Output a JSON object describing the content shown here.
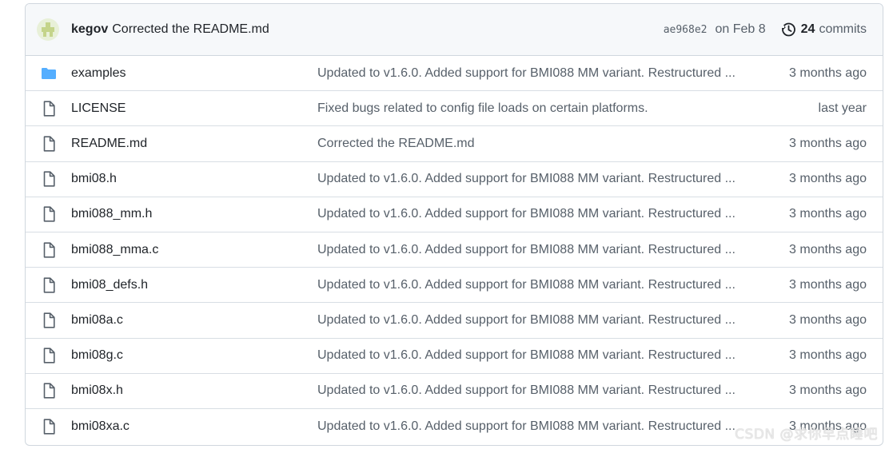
{
  "latest_commit": {
    "author": "kegov",
    "message": "Corrected the README.md",
    "sha": "ae968e2",
    "date": "on Feb 8",
    "commits_count": "24",
    "commits_label": "commits"
  },
  "files": [
    {
      "type": "folder",
      "icon": "folder-icon",
      "name": "examples",
      "message": "Updated to v1.6.0. Added support for BMI088 MM variant. Restructured ...",
      "age": "3 months ago"
    },
    {
      "type": "file",
      "icon": "file-icon",
      "name": "LICENSE",
      "message": "Fixed bugs related to config file loads on certain platforms.",
      "age": "last year"
    },
    {
      "type": "file",
      "icon": "file-icon",
      "name": "README.md",
      "message": "Corrected the README.md",
      "age": "3 months ago"
    },
    {
      "type": "file",
      "icon": "file-icon",
      "name": "bmi08.h",
      "message": "Updated to v1.6.0. Added support for BMI088 MM variant. Restructured ...",
      "age": "3 months ago"
    },
    {
      "type": "file",
      "icon": "file-icon",
      "name": "bmi088_mm.h",
      "message": "Updated to v1.6.0. Added support for BMI088 MM variant. Restructured ...",
      "age": "3 months ago"
    },
    {
      "type": "file",
      "icon": "file-icon",
      "name": "bmi088_mma.c",
      "message": "Updated to v1.6.0. Added support for BMI088 MM variant. Restructured ...",
      "age": "3 months ago"
    },
    {
      "type": "file",
      "icon": "file-icon",
      "name": "bmi08_defs.h",
      "message": "Updated to v1.6.0. Added support for BMI088 MM variant. Restructured ...",
      "age": "3 months ago"
    },
    {
      "type": "file",
      "icon": "file-icon",
      "name": "bmi08a.c",
      "message": "Updated to v1.6.0. Added support for BMI088 MM variant. Restructured ...",
      "age": "3 months ago"
    },
    {
      "type": "file",
      "icon": "file-icon",
      "name": "bmi08g.c",
      "message": "Updated to v1.6.0. Added support for BMI088 MM variant. Restructured ...",
      "age": "3 months ago"
    },
    {
      "type": "file",
      "icon": "file-icon",
      "name": "bmi08x.h",
      "message": "Updated to v1.6.0. Added support for BMI088 MM variant. Restructured ...",
      "age": "3 months ago"
    },
    {
      "type": "file",
      "icon": "file-icon",
      "name": "bmi08xa.c",
      "message": "Updated to v1.6.0. Added support for BMI088 MM variant. Restructured ...",
      "age": "3 months ago"
    }
  ],
  "watermark": "CSDN @求你早点睡吧",
  "colors": {
    "folder": "#54aeff",
    "file_icon": "#57606a",
    "muted_text": "#57606a",
    "header_bg": "#f6f8fa",
    "border": "#d0d7de"
  }
}
